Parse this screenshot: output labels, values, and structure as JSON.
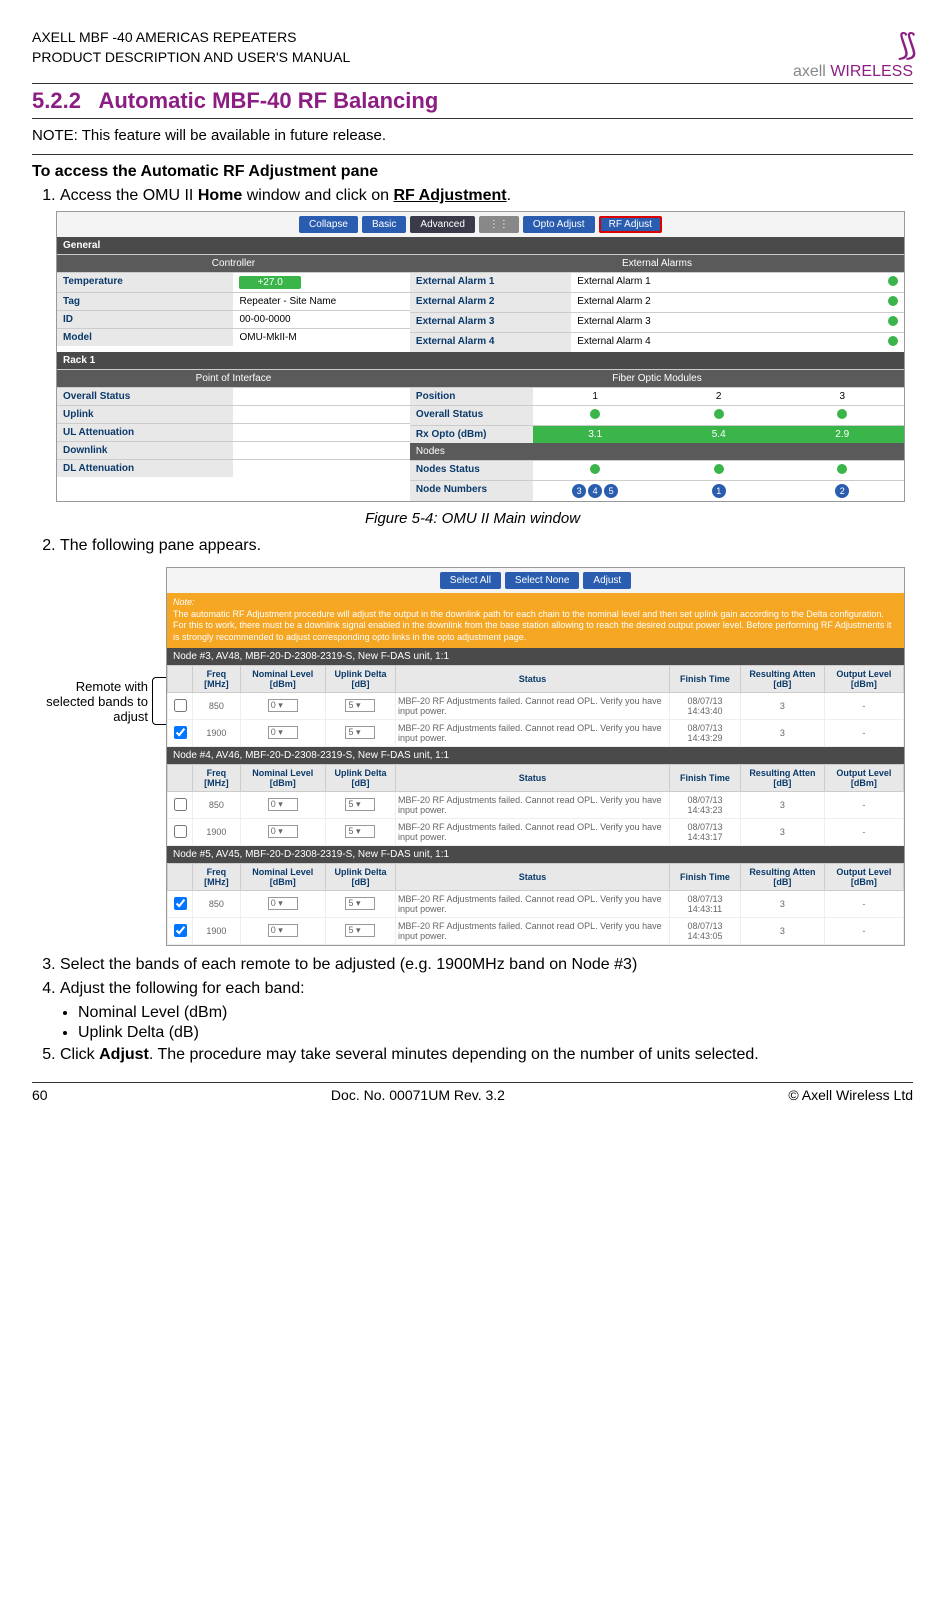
{
  "header": {
    "line1": "AXELL MBF -40 AMERICAS REPEATERS",
    "line2": "PRODUCT DESCRIPTION AND USER'S MANUAL",
    "logo_brand": "axell",
    "logo_sub": "WIRELESS"
  },
  "section": {
    "number": "5.2.2",
    "title": "Automatic MBF-40 RF Balancing"
  },
  "note": "NOTE: This feature will be available in future release.",
  "access_heading": "To access the Automatic RF Adjustment pane",
  "step1a": "Access the OMU II ",
  "step1b": "Home",
  "step1c": " window and click on ",
  "step1d": "RF Adjustment",
  "step1e": ".",
  "fig1": {
    "toolbar": [
      "Collapse",
      "Basic",
      "Advanced",
      "Opto Adjust",
      "RF Adjust"
    ],
    "general": "General",
    "controller": "Controller",
    "ext_alarms_title": "External Alarms",
    "temperature_label": "Temperature",
    "temperature_val": "+27.0",
    "tag_label": "Tag",
    "tag_val": "Repeater - Site Name",
    "id_label": "ID",
    "id_val": "00-00-0000",
    "model_label": "Model",
    "model_val": "OMU-MkII-M",
    "ext_alarm_labels": [
      "External Alarm 1",
      "External Alarm 2",
      "External Alarm 3",
      "External Alarm 4"
    ],
    "ext_alarm_vals": [
      "External Alarm 1",
      "External Alarm 2",
      "External Alarm 3",
      "External Alarm 4"
    ],
    "rack": "Rack 1",
    "poi": "Point of Interface",
    "fom": "Fiber Optic Modules",
    "overall_status": "Overall Status",
    "uplink": "Uplink",
    "ul_atten": "UL Attenuation",
    "downlink": "Downlink",
    "dl_atten": "DL Attenuation",
    "position": "Position",
    "rx_opto": "Rx Opto (dBm)",
    "nodes": "Nodes",
    "nodes_status": "Nodes Status",
    "node_numbers": "Node Numbers",
    "positions": [
      "1",
      "2",
      "3"
    ],
    "rx_vals": [
      "3.1",
      "5.4",
      "2.9"
    ],
    "node_num_groups": [
      "345",
      "1",
      "2"
    ]
  },
  "caption1": "Figure 5-4: OMU II Main window",
  "step2": "The following pane appears.",
  "annotation": "Remote with selected bands to adjust",
  "fig2": {
    "toolbar": [
      "Select All",
      "Select None",
      "Adjust"
    ],
    "note_title": "Note:",
    "note_body": "The automatic RF Adjustment procedure will adjust the output in the downlink path for each chain to the nominal level and then set uplink gain according to the Delta configuration. For this to work, there must be a downlink signal enabled in the downlink from the base station allowing to reach the desired output power level. Before performing RF Adjustments it is strongly recommended to adjust corresponding opto links in the opto adjustment page.",
    "col_freq": "Freq [MHz]",
    "col_nom": "Nominal Level [dBm]",
    "col_upl": "Uplink Delta [dB]",
    "col_status": "Status",
    "col_finish": "Finish Time",
    "col_atten": "Resulting Atten [dB]",
    "col_out": "Output Level [dBm]",
    "status_msg": "MBF-20 RF Adjustments failed. Cannot read OPL. Verify you have input power.",
    "nodes": [
      {
        "title": "Node #3, AV48, MBF-20-D-2308-2319-S, New F-DAS unit, 1:1",
        "rows": [
          {
            "chk": false,
            "freq": "850",
            "nom": "0",
            "upl": "5",
            "time": "08/07/13 14:43:40",
            "atten": "3",
            "out": "-"
          },
          {
            "chk": true,
            "freq": "1900",
            "nom": "0",
            "upl": "5",
            "time": "08/07/13 14:43:29",
            "atten": "3",
            "out": "-"
          }
        ]
      },
      {
        "title": "Node #4, AV46, MBF-20-D-2308-2319-S, New F-DAS unit, 1:1",
        "rows": [
          {
            "chk": false,
            "freq": "850",
            "nom": "0",
            "upl": "5",
            "time": "08/07/13 14:43:23",
            "atten": "3",
            "out": "-"
          },
          {
            "chk": false,
            "freq": "1900",
            "nom": "0",
            "upl": "5",
            "time": "08/07/13 14:43:17",
            "atten": "3",
            "out": "-"
          }
        ]
      },
      {
        "title": "Node #5, AV45, MBF-20-D-2308-2319-S, New F-DAS unit, 1:1",
        "rows": [
          {
            "chk": true,
            "freq": "850",
            "nom": "0",
            "upl": "5",
            "time": "08/07/13 14:43:11",
            "atten": "3",
            "out": "-"
          },
          {
            "chk": true,
            "freq": "1900",
            "nom": "0",
            "upl": "5",
            "time": "08/07/13 14:43:05",
            "atten": "3",
            "out": "-"
          }
        ]
      }
    ]
  },
  "step3": "Select the bands of each remote to be adjusted (e.g. 1900MHz band on Node #3)",
  "step4": "Adjust the following for each band:",
  "bullet1": "Nominal Level (dBm)",
  "bullet2": "Uplink Delta (dB)",
  "step5a": "Click ",
  "step5b": "Adjust",
  "step5c": ". The procedure may take several minutes depending on the number of units selected.",
  "footer": {
    "page": "60",
    "doc": "Doc. No. 00071UM Rev. 3.2",
    "copyright": "© Axell Wireless Ltd"
  }
}
